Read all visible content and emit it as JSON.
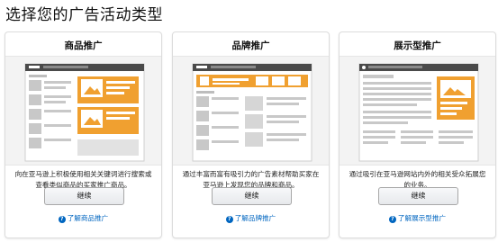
{
  "page": {
    "title": "选择您的广告活动类型"
  },
  "colors": {
    "accent_orange": "#f0a030",
    "link_blue": "#0066c0",
    "mockup_gray": "#c8c8c8"
  },
  "cards": [
    {
      "title": "商品推广",
      "description": "向在亚马逊上积极使用相关关键词进行搜索或查看类似商品的买家推广商品。",
      "button_label": "继续",
      "learn_more": "了解商品推广",
      "learn_icon": "question-circle-icon",
      "preview_icon": "sponsored-products-preview"
    },
    {
      "title": "品牌推广",
      "description": "通过丰富而富有吸引力的广告素材帮助买家在亚马逊上发现您的品牌和商品。",
      "button_label": "继续",
      "learn_more": "了解品牌推广",
      "learn_icon": "question-circle-icon",
      "preview_icon": "sponsored-brands-preview"
    },
    {
      "title": "展示型推广",
      "description": "通过吸引在亚马逊网站内外的相关受众拓展您的业务。",
      "button_label": "继续",
      "learn_more": "了解展示型推广",
      "learn_icon": "question-circle-icon",
      "preview_icon": "sponsored-display-preview"
    }
  ]
}
